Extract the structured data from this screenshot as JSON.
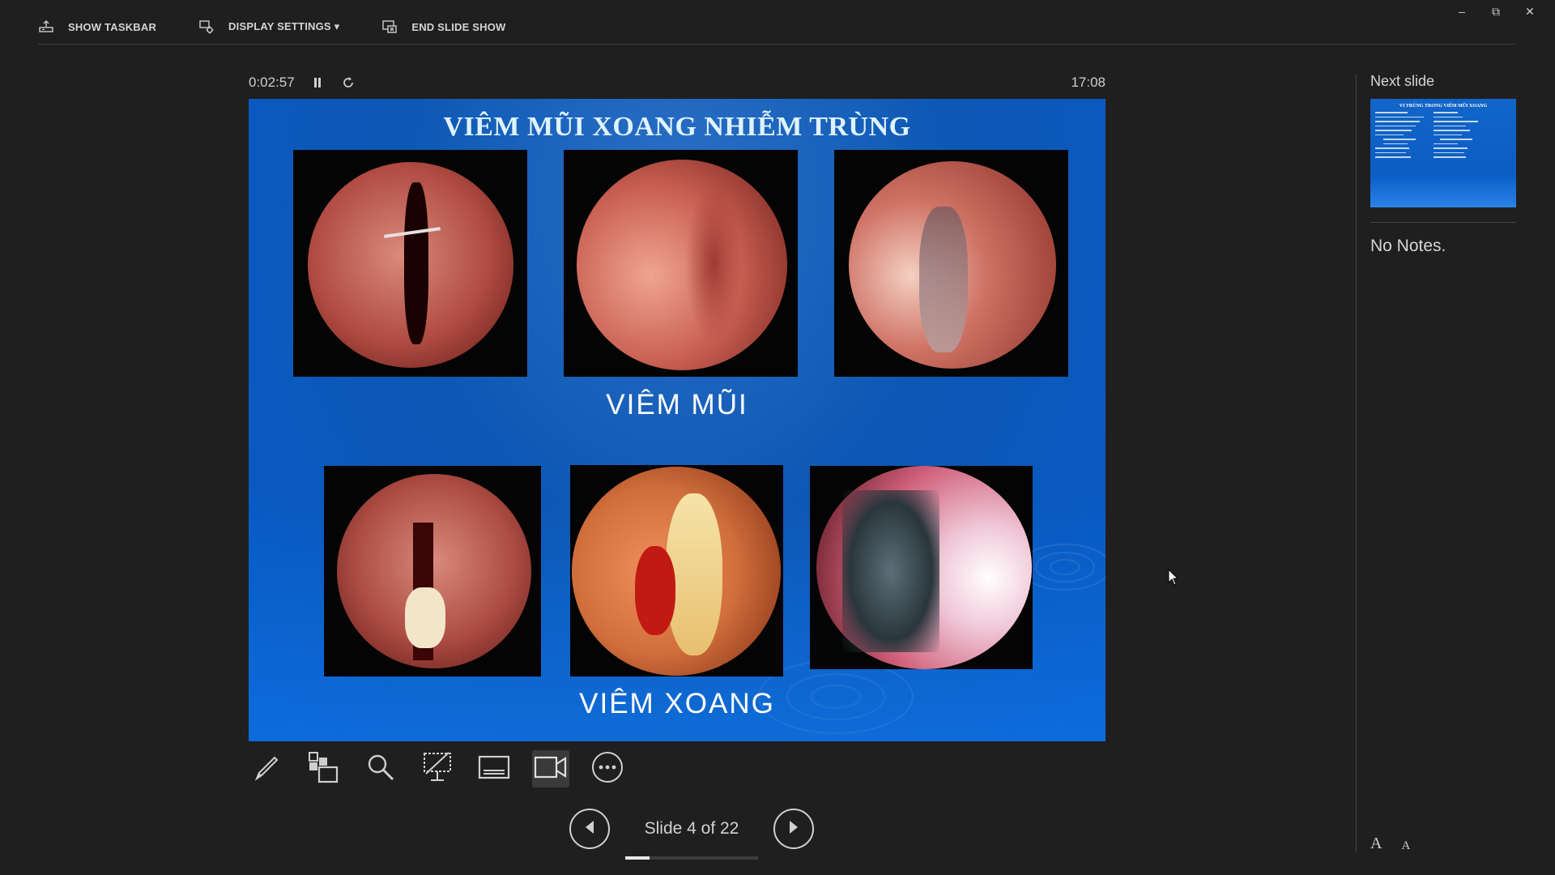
{
  "toolbar": {
    "show_taskbar": "SHOW TASKBAR",
    "display_settings": "DISPLAY SETTINGS ▾",
    "end_slide_show": "END SLIDE SHOW"
  },
  "timer": {
    "elapsed": "0:02:57",
    "clock": "17:08"
  },
  "slide": {
    "title": "VIÊM MŨI XOANG NHIỄM TRÙNG",
    "caption_top": "VIÊM MŨI",
    "caption_bottom": "VIÊM XOANG"
  },
  "navigation": {
    "counter": "Slide 4 of 22",
    "current": 4,
    "total": 22
  },
  "right_pane": {
    "next_slide_label": "Next slide",
    "next_slide_title": "VI TRÙNG TRONG VIÊM MŨI XOANG",
    "notes": "No Notes."
  },
  "font_buttons": {
    "increase": "A",
    "decrease": "A"
  },
  "icons": {
    "show_taskbar": "taskbar-icon",
    "display_settings": "display-settings-icon",
    "end_slide_show": "end-show-icon",
    "pause": "pause-icon",
    "restart": "restart-icon",
    "pen": "pen-icon",
    "see_all_slides": "see-all-slides-icon",
    "zoom": "zoom-icon",
    "black_screen": "black-screen-icon",
    "subtitles": "subtitles-icon",
    "camera": "camera-icon",
    "more": "more-options-icon",
    "previous": "previous-slide-icon",
    "next": "next-slide-icon"
  },
  "colors": {
    "background": "#1f1f1f",
    "slide_blue": "#0d58b5",
    "slide_title": "#dff3ff",
    "text": "#d6d6d6"
  }
}
